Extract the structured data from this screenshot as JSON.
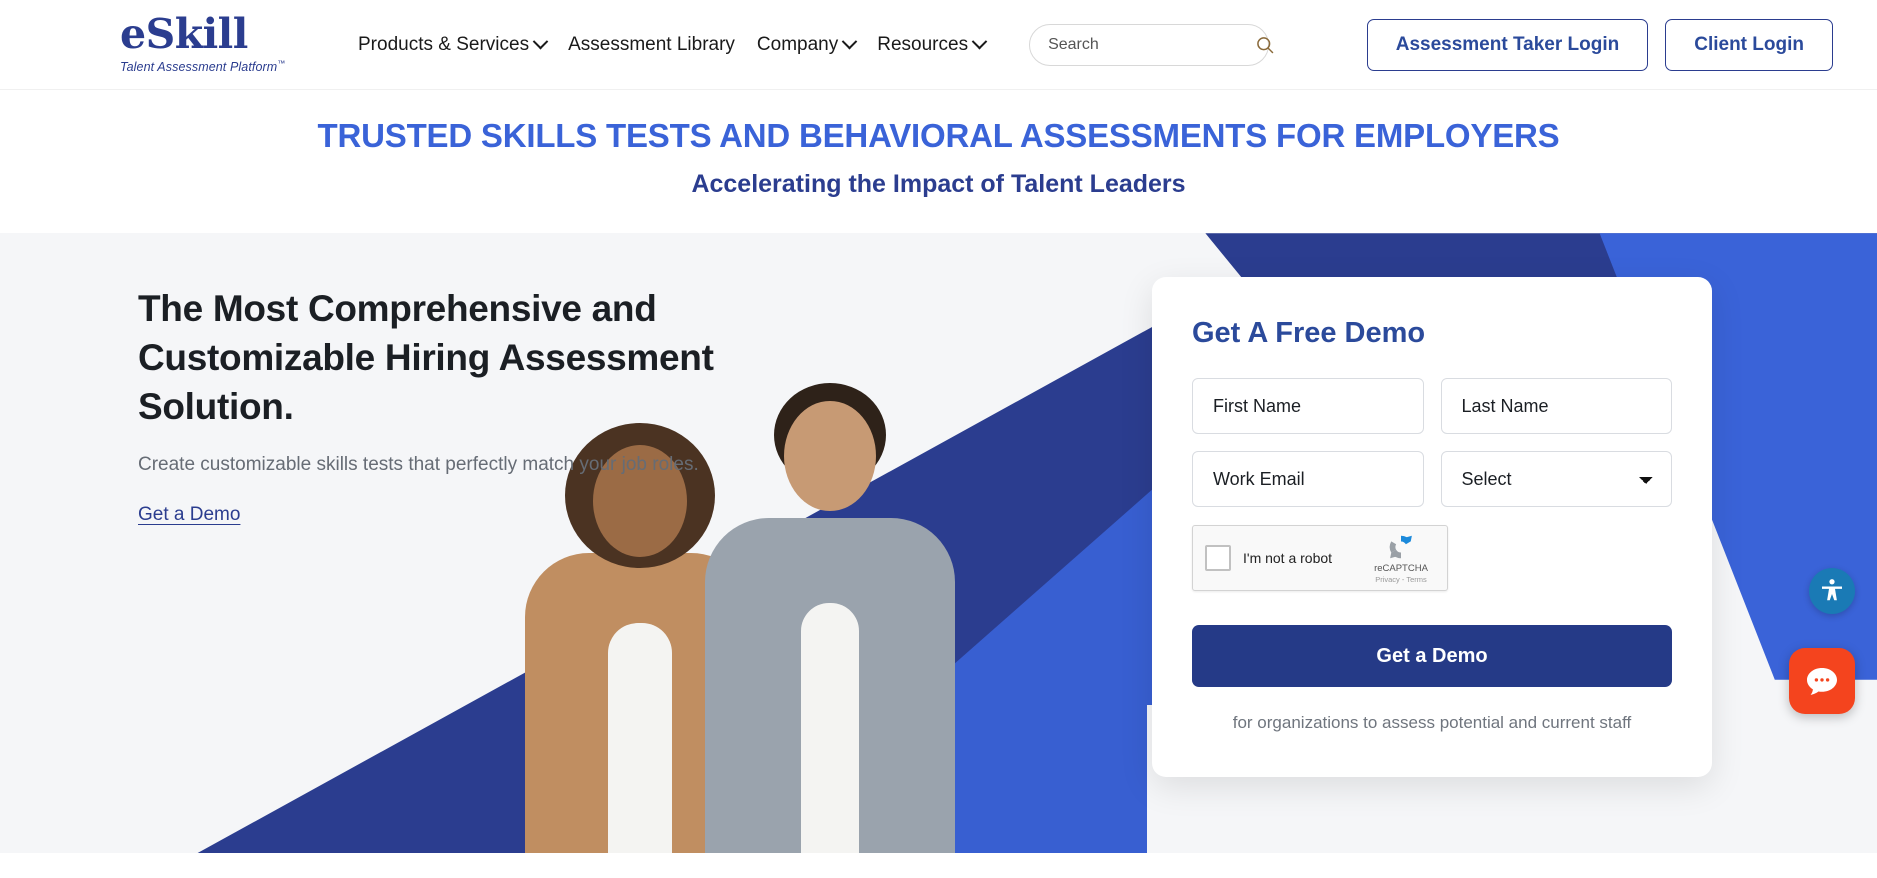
{
  "header": {
    "logo": {
      "name": "eSkill",
      "tagline": "Talent Assessment Platform",
      "tm": "™"
    },
    "nav": [
      {
        "label": "Products & Services",
        "has_caret": true
      },
      {
        "label": "Assessment Library",
        "has_caret": false
      },
      {
        "label": "Company",
        "has_caret": true
      },
      {
        "label": "Resources",
        "has_caret": true
      }
    ],
    "search": {
      "placeholder": "Search",
      "value": "",
      "icon": "search-icon"
    },
    "actions": [
      {
        "label": "Assessment Taker Login"
      },
      {
        "label": "Client Login"
      }
    ]
  },
  "banner": {
    "title": "TRUSTED SKILLS TESTS AND BEHAVIORAL ASSESSMENTS FOR EMPLOYERS",
    "subtitle": "Accelerating the Impact of Talent Leaders"
  },
  "hero": {
    "heading": "The Most Comprehensive and Customizable Hiring Assessment Solution.",
    "paragraph": "Create customizable skills tests that perfectly match your job roles.",
    "link_label": "Get a Demo"
  },
  "form": {
    "title": "Get A Free Demo",
    "fields": {
      "first_name": {
        "placeholder": "First Name",
        "value": ""
      },
      "last_name": {
        "placeholder": "Last Name",
        "value": ""
      },
      "work_email": {
        "placeholder": "Work Email",
        "value": ""
      },
      "select": {
        "selected": "Select"
      }
    },
    "recaptcha": {
      "label": "I'm not a robot",
      "brand": "reCAPTCHA",
      "terms": "Privacy - Terms"
    },
    "submit_label": "Get a Demo",
    "note": "for organizations to assess potential and current staff"
  },
  "widgets": {
    "accessibility": {
      "name": "accessibility-icon"
    },
    "chat": {
      "name": "chat-bubble-icon"
    }
  },
  "colors": {
    "brand_navy": "#2b3d8f",
    "brand_blue": "#3a63d8",
    "button_navy": "#253a87",
    "chat_orange": "#f4441e",
    "access_blue": "#1a7ab5"
  }
}
